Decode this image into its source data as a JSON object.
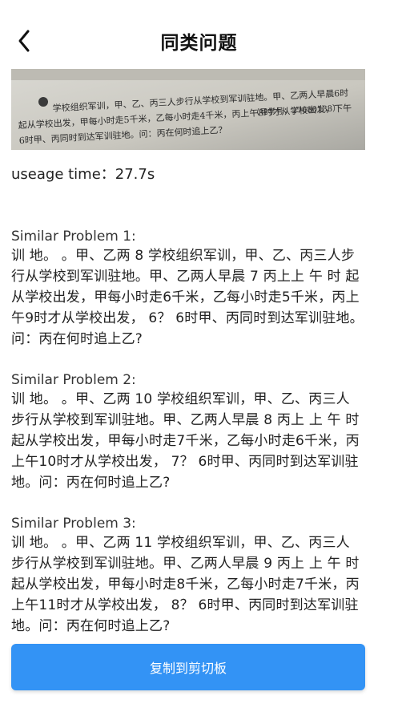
{
  "header": {
    "title": "同类问题"
  },
  "photo": {
    "lines": [
      "学校组织军训，甲、乙、丙三人步行从学校到军训驻地。甲、乙两人早晨6时",
      "起从学校出发，甲每小时走5千米，乙每小时走4千米，丙上午8时才从学校出发，下午",
      "6时甲、丙同时到达军训驻地。问：丙在何时追上乙？",
      "（导学号：27680138）"
    ]
  },
  "usage": {
    "text": "useage time：27.7s"
  },
  "problems": [
    {
      "heading": "Similar Problem 1:",
      "body": "训 地。 。甲、乙两 8 学校组织军训，甲、乙、丙三人步行从学校到军训驻地。甲、乙两人早晨 7 丙上上 午 时 起从学校出发，甲每小时走6千米，乙每小时走5千米，丙上午9时才从学校出发， 6？ 6时甲、丙同时到达军训驻地。问：丙在何时追上乙?"
    },
    {
      "heading": "Similar Problem 2:",
      "body": "训 地。 。甲、乙两 10 学校组织军训，甲、乙、丙三人步行从学校到军训驻地。甲、乙两人早晨 8 丙上 上 午 时 起从学校出发，甲每小时走7千米，乙每小时走6千米，丙上午10时才从学校出发， 7？ 6时甲、丙同时到达军训驻地。问：丙在何时追上乙?"
    },
    {
      "heading": "Similar Problem 3:",
      "body": "训 地。 。甲、乙两 11 学校组织军训，甲、乙、丙三人步行从学校到军训驻地。甲、乙两人早晨 9 丙上 上 午 时 起从学校出发，甲每小时走8千米，乙每小时走7千米，丙上午11时才从学校出发， 8？ 6时甲、丙同时到达军训驻地。问：丙在何时追上乙?"
    }
  ],
  "copy_button": {
    "label": "复制到剪切板"
  },
  "colors": {
    "accent": "#3393f5",
    "background": "#ffffff",
    "text": "#222222"
  },
  "icons": {
    "back": "chevron-left-icon"
  }
}
